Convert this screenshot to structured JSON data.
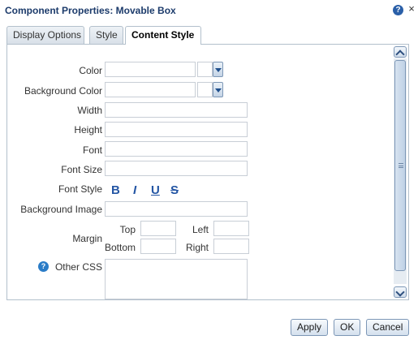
{
  "dialog": {
    "title": "Component Properties: Movable Box",
    "help": "?",
    "close": "×"
  },
  "tabs": [
    {
      "label": "Display Options"
    },
    {
      "label": "Style"
    },
    {
      "label": "Content Style",
      "active": true
    }
  ],
  "form": {
    "color": {
      "label": "Color",
      "value": ""
    },
    "background_color": {
      "label": "Background Color",
      "value": ""
    },
    "width": {
      "label": "Width",
      "value": ""
    },
    "height": {
      "label": "Height",
      "value": ""
    },
    "font": {
      "label": "Font",
      "value": ""
    },
    "font_size": {
      "label": "Font Size",
      "value": ""
    },
    "font_style": {
      "label": "Font Style",
      "bold": "B",
      "italic": "I",
      "underline": "U",
      "strike": "S"
    },
    "background_image": {
      "label": "Background Image",
      "value": ""
    },
    "margin": {
      "label": "Margin",
      "top_label": "Top",
      "left_label": "Left",
      "bottom_label": "Bottom",
      "right_label": "Right",
      "top": "",
      "left": "",
      "bottom": "",
      "right": ""
    },
    "other_css": {
      "label": "Other CSS",
      "value": "",
      "help": "?"
    }
  },
  "buttons": {
    "apply": "Apply",
    "ok": "OK",
    "cancel": "Cancel"
  },
  "colors": {
    "title": "#1c3b6b",
    "accent": "#2456a4",
    "border": "#b3c0cc"
  }
}
